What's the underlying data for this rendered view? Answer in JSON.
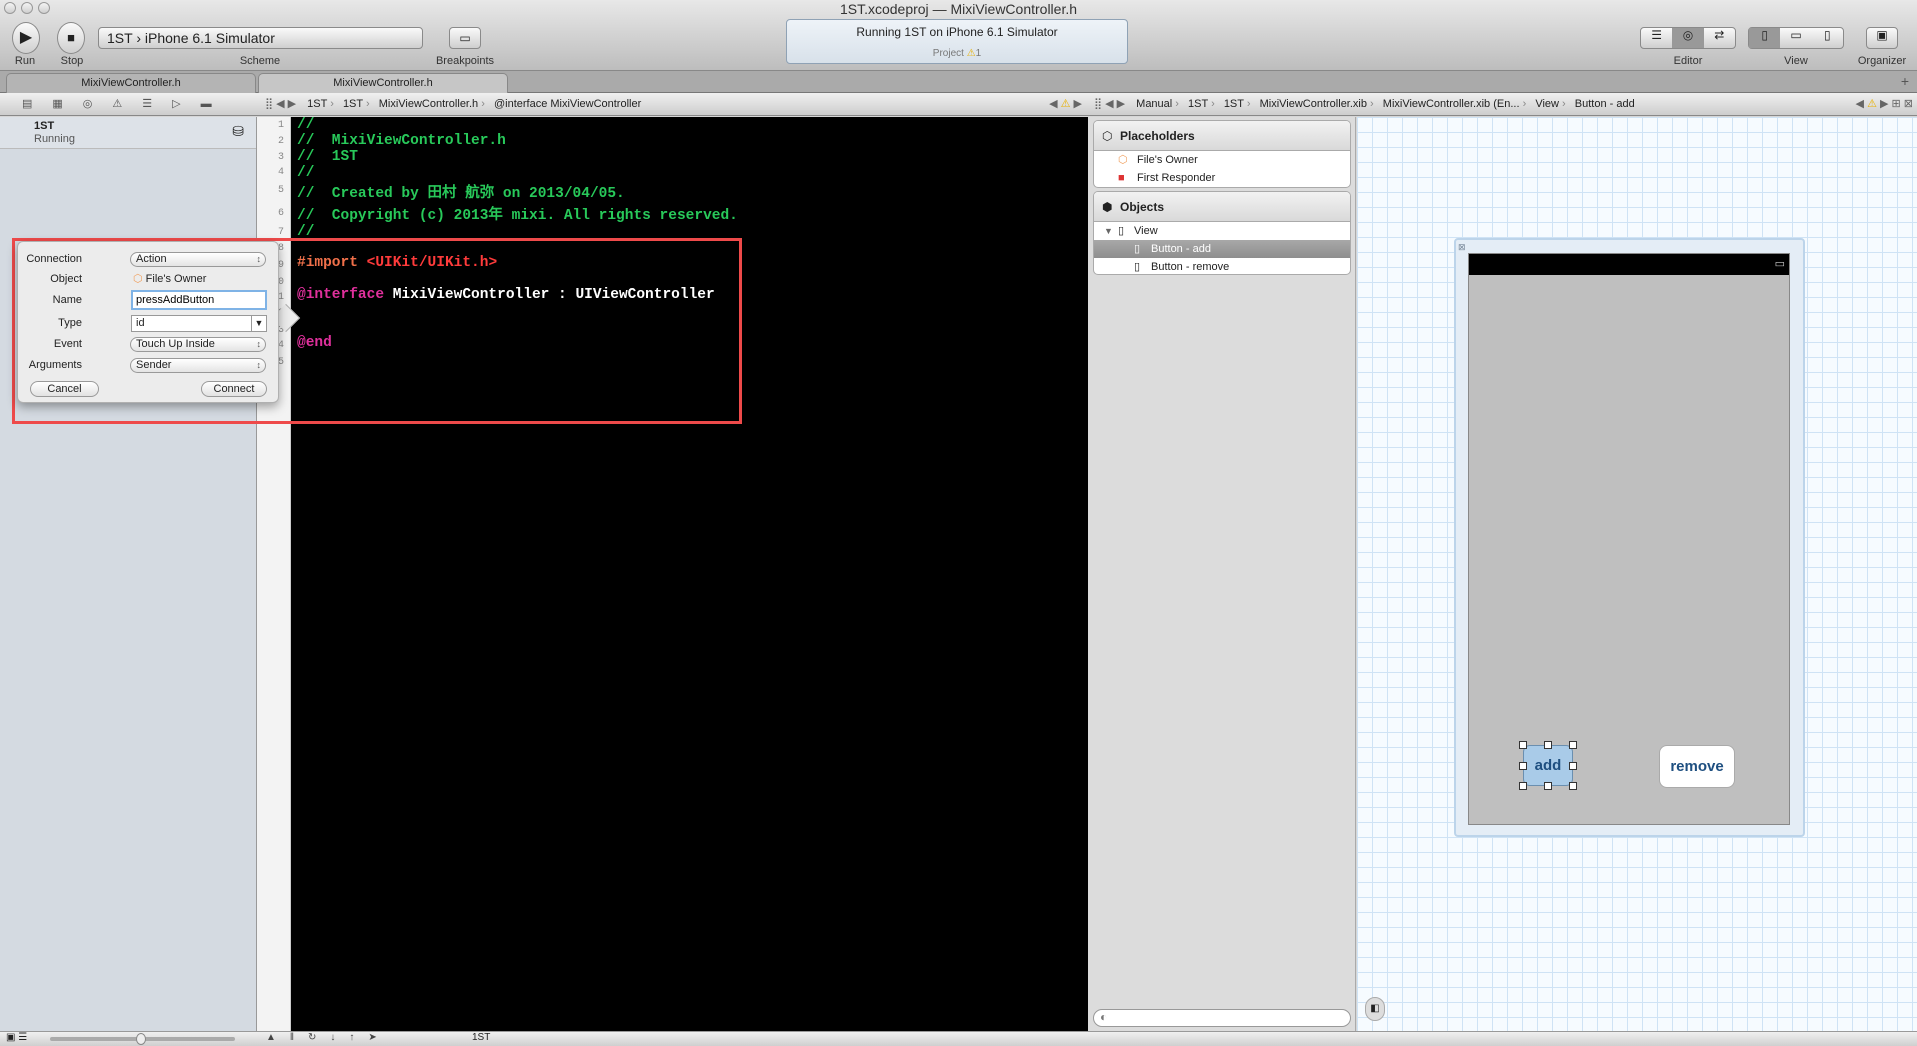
{
  "window": {
    "title_project": "1ST.xcodeproj",
    "title_sep": "—",
    "title_file": "MixiViewController.h"
  },
  "toolbar": {
    "run": "Run",
    "stop": "Stop",
    "scheme_target": "1ST",
    "scheme_device": "iPhone 6.1 Simulator",
    "scheme_label": "Scheme",
    "breakpoints": "Breakpoints",
    "activity": "Running 1ST on iPhone 6.1 Simulator",
    "activity_sub": "Project",
    "warning_count": "1",
    "editor": "Editor",
    "view": "View",
    "organizer": "Organizer"
  },
  "tabs": [
    {
      "label": "MixiViewController.h"
    },
    {
      "label": "MixiViewController.h"
    }
  ],
  "jump_left": [
    "1ST",
    "1ST",
    "MixiViewController.h",
    "@interface MixiViewController"
  ],
  "jump_right": [
    "Manual",
    "1ST",
    "1ST",
    "MixiViewController.xib",
    "MixiViewController.xib (En...",
    "View",
    "Button - add"
  ],
  "sidebar": {
    "name": "1ST",
    "status": "Running"
  },
  "code": {
    "lines": [
      "1",
      "2",
      "3",
      "4",
      "5",
      "6",
      "7",
      "8",
      "9",
      "10",
      "11",
      "12",
      "13",
      "14",
      "15"
    ],
    "l1": "//",
    "l2": "//  MixiViewController.h",
    "l3": "//  1ST",
    "l4": "//",
    "l5": "//  Created by 田村 航弥 on 2013/04/05.",
    "l6": "//  Copyright (c) 2013年 mixi. All rights reserved.",
    "l7": "//",
    "import_kw": "#import",
    "import_path": "<UIKit/UIKit.h>",
    "iface_kw": "@interface",
    "iface_rest": " MixiViewController : UIViewController",
    "end_kw": "@end"
  },
  "popover": {
    "connection_label": "Connection",
    "connection": "Action",
    "object_label": "Object",
    "object": "File's Owner",
    "name_label": "Name",
    "name": "pressAddButton",
    "type_label": "Type",
    "type": "id",
    "event_label": "Event",
    "event": "Touch Up Inside",
    "arguments_label": "Arguments",
    "arguments": "Sender",
    "cancel": "Cancel",
    "connect": "Connect"
  },
  "outline": {
    "placeholders": "Placeholders",
    "files_owner": "File's Owner",
    "first_responder": "First Responder",
    "objects": "Objects",
    "view": "View",
    "button_add": "Button - add",
    "button_remove": "Button - remove"
  },
  "canvas": {
    "add": "add",
    "remove": "remove"
  },
  "bottom": {
    "target": "1ST"
  },
  "colors": {
    "highlight_box": "#ee4a4a",
    "comment": "#28c95a",
    "keyword": "#e0309c",
    "selected_button": "#a9cbe8"
  }
}
